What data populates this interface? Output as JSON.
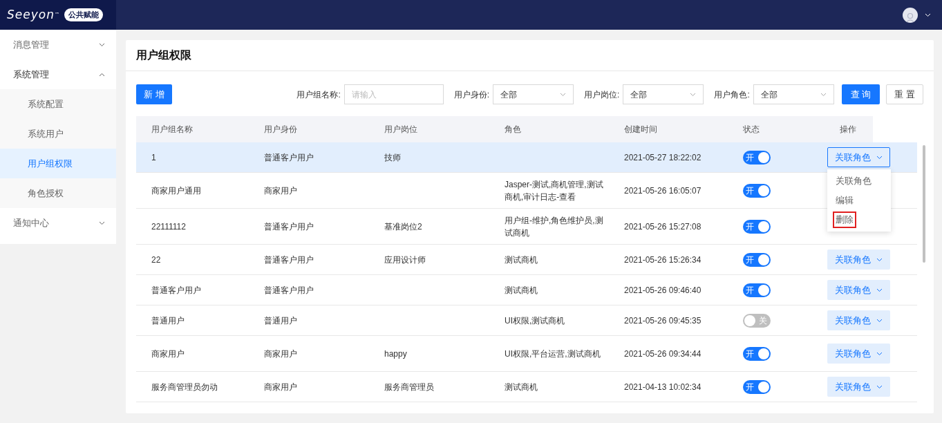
{
  "header": {
    "logo": "Seeyon",
    "logo_mark": "™",
    "badge": "公共赋能"
  },
  "sidebar": {
    "items": [
      {
        "label": "消息管理",
        "expanded": false,
        "selected": false
      },
      {
        "label": "系统管理",
        "expanded": true,
        "selected": false,
        "children": [
          {
            "label": "系统配置",
            "selected": false
          },
          {
            "label": "系统用户",
            "selected": false
          },
          {
            "label": "用户组权限",
            "selected": true
          },
          {
            "label": "角色授权",
            "selected": false
          }
        ]
      },
      {
        "label": "通知中心",
        "expanded": false,
        "selected": false
      }
    ]
  },
  "page": {
    "title": "用户组权限",
    "add_button": "新 增",
    "filters": [
      {
        "kind": "text",
        "label": "用户组名称:",
        "placeholder": "请输入"
      },
      {
        "kind": "select",
        "label": "用户身份:",
        "value": "全部"
      },
      {
        "kind": "select",
        "label": "用户岗位:",
        "value": "全部"
      },
      {
        "kind": "select",
        "label": "用户角色:",
        "value": "全部"
      }
    ],
    "query_button": "查 询",
    "reset_button": "重 置"
  },
  "table": {
    "columns": [
      "用户组名称",
      "用户身份",
      "用户岗位",
      "角色",
      "创建时间",
      "状态",
      "操作"
    ],
    "rows": [
      {
        "selected": true,
        "cells": [
          "1",
          "普通客户用户",
          "技师",
          "",
          "2021-05-27 18:22:02"
        ],
        "on": true,
        "switch_label": "开",
        "action": {
          "label": "关联角色",
          "expanded": true
        }
      },
      {
        "selected": false,
        "cells": [
          "商家用户通用",
          "商家用户",
          "",
          "Jasper-测试,商机管理,测试商机,审计日志-查看",
          "2021-05-26 16:05:07"
        ],
        "on": true,
        "switch_label": "开"
      },
      {
        "selected": false,
        "cells": [
          "22111112",
          "普通客户用户",
          "基准岗位2",
          "用户组-维护,角色维护员,测试商机",
          "2021-05-26 15:27:08"
        ],
        "on": true,
        "switch_label": "开"
      },
      {
        "selected": false,
        "cells": [
          "22",
          "普通客户用户",
          "应用设计师",
          "测试商机",
          "2021-05-26 15:26:34"
        ],
        "on": true,
        "switch_label": "开",
        "action": {
          "label": "关联角色",
          "expanded": false
        }
      },
      {
        "selected": false,
        "cells": [
          "普通客户用户",
          "普通客户用户",
          "",
          "测试商机",
          "2021-05-26 09:46:40"
        ],
        "on": true,
        "switch_label": "开",
        "action": {
          "label": "关联角色",
          "expanded": false
        }
      },
      {
        "selected": false,
        "cells": [
          "普通用户",
          "普通用户",
          "",
          "UI权限,测试商机",
          "2021-05-26 09:45:35"
        ],
        "on": false,
        "switch_label": "关",
        "action": {
          "label": "关联角色",
          "expanded": false
        }
      },
      {
        "selected": false,
        "cells": [
          "商家用户",
          "商家用户",
          "happy",
          "UI权限,平台运营,测试商机",
          "2021-05-26 09:34:44"
        ],
        "on": true,
        "switch_label": "开",
        "action": {
          "label": "关联角色",
          "expanded": false
        }
      },
      {
        "selected": false,
        "cells": [
          "服务商管理员勿动",
          "商家用户",
          "服务商管理员",
          "测试商机",
          "2021-04-13 10:02:34"
        ],
        "on": true,
        "switch_label": "开",
        "action": {
          "label": "关联角色",
          "expanded": false
        }
      }
    ]
  },
  "action_menu": [
    {
      "label": "关联角色",
      "marked": false
    },
    {
      "label": "编辑",
      "marked": false
    },
    {
      "label": "删除",
      "marked": true
    }
  ]
}
